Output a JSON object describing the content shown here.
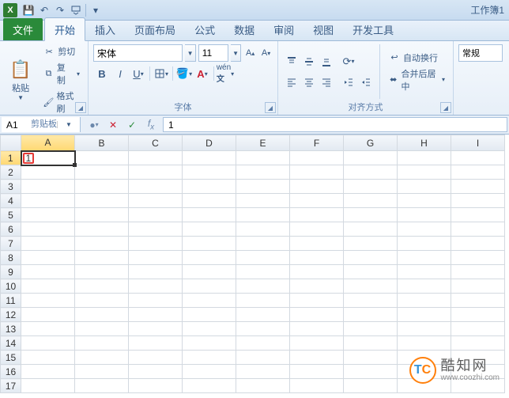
{
  "qat": {
    "save": "💾",
    "undo": "↶",
    "redo": "↷",
    "more": "▾"
  },
  "doc_title": "工作簿1",
  "tabs": {
    "file": "文件",
    "home": "开始",
    "insert": "插入",
    "layout": "页面布局",
    "formula": "公式",
    "data": "数据",
    "review": "审阅",
    "view": "视图",
    "dev": "开发工具"
  },
  "clipboard": {
    "paste": "粘贴",
    "cut": "剪切",
    "copy": "复制",
    "painter": "格式刷",
    "group": "剪贴板"
  },
  "font": {
    "name": "宋体",
    "size": "11",
    "group": "字体"
  },
  "align": {
    "wrap": "自动换行",
    "merge": "合并后居中",
    "group": "对齐方式"
  },
  "number": {
    "general": "常规"
  },
  "formula_bar": {
    "cellref": "A1",
    "value": "1"
  },
  "columns": [
    "A",
    "B",
    "C",
    "D",
    "E",
    "F",
    "G",
    "H",
    "I"
  ],
  "rows": 17,
  "active": {
    "row": 1,
    "col": "A",
    "value": "1"
  },
  "watermark": {
    "brand": "酷知网",
    "url": "www.coozhi.com"
  }
}
